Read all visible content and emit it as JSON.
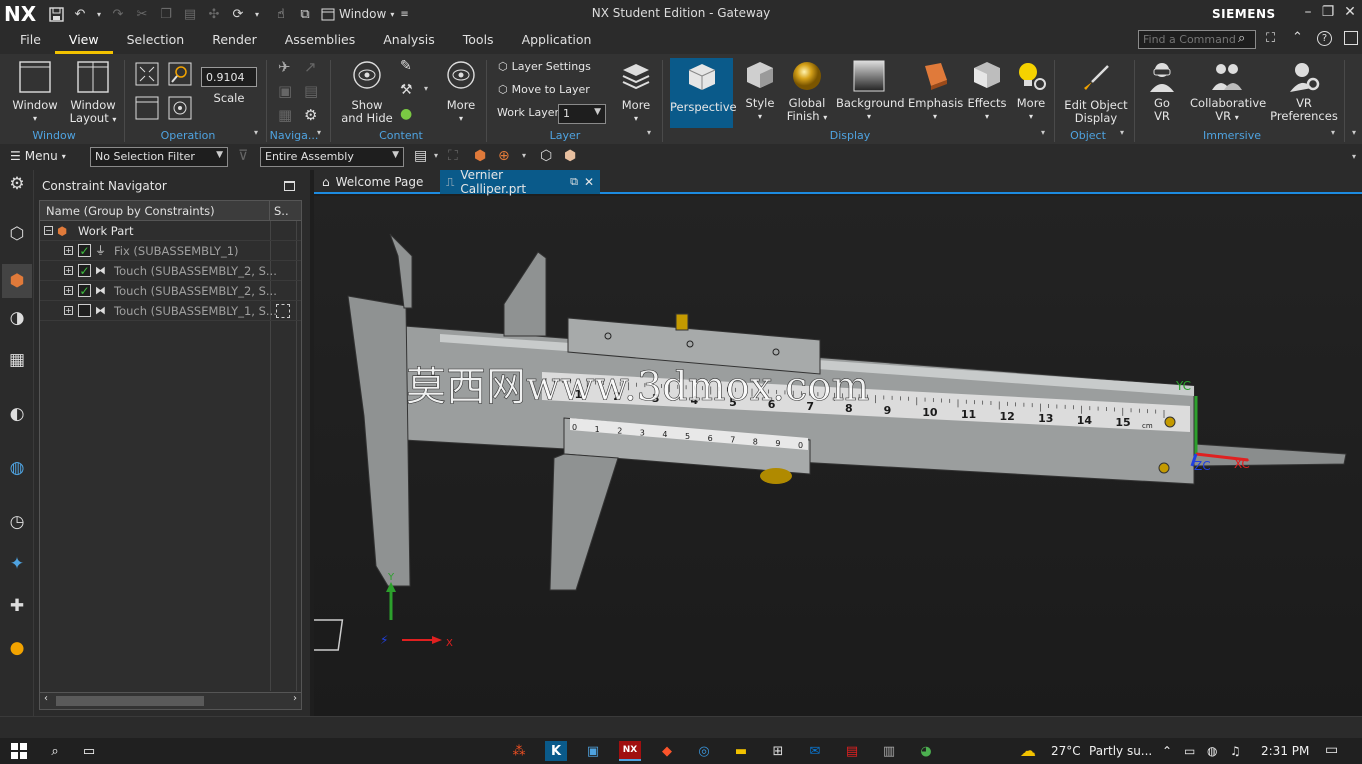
{
  "app": {
    "logo": "NX",
    "window_title": "NX Student Edition - Gateway",
    "window_menu_label": "Window",
    "brand": "SIEMENS",
    "accent_color": "#f2c200",
    "link_color": "#4fa3e0"
  },
  "menubar": {
    "tabs": [
      "File",
      "View",
      "Selection",
      "Render",
      "Assemblies",
      "Analysis",
      "Tools",
      "Application"
    ],
    "active_tab": "View",
    "find_command_placeholder": "Find a Command"
  },
  "ribbon": {
    "window_button": "Window",
    "window_layout_1": "Window",
    "window_layout_2": "Layout",
    "group_window": "Window",
    "scale_value": "0.9104",
    "scale_label": "Scale",
    "group_operation": "Operation",
    "group_navigation": "Naviga...",
    "show_hide_1": "Show",
    "show_hide_2": "and Hide",
    "content_more": "More",
    "group_content": "Content",
    "layer_settings": "Layer Settings",
    "move_to_layer": "Move to Layer",
    "work_layer_label": "Work Layer",
    "work_layer_value": "1",
    "layer_more": "More",
    "group_layer": "Layer",
    "perspective": "Perspective",
    "style": "Style",
    "global_finish_1": "Global",
    "global_finish_2": "Finish",
    "background": "Background",
    "emphasis": "Emphasis",
    "effects": "Effects",
    "display_more": "More",
    "group_display": "Display",
    "edit_object_display_1": "Edit Object",
    "edit_object_display_2": "Display",
    "group_object": "Object",
    "go_vr_1": "Go",
    "go_vr_2": "VR",
    "collab_vr_1": "Collaborative",
    "collab_vr_2": "VR",
    "vr_prefs_1": "VR",
    "vr_prefs_2": "Preferences",
    "group_immersive": "Immersive"
  },
  "toolbar2": {
    "menu_label": "Menu",
    "selection_filter": "No Selection Filter",
    "scope": "Entire Assembly"
  },
  "navigator": {
    "title": "Constraint Navigator",
    "col_name": "Name (Group by Constraints)",
    "col_status": "S..",
    "root": "Work Part",
    "rows": [
      {
        "label": "Fix (SUBASSEMBLY_1)",
        "checked": true
      },
      {
        "label": "Touch (SUBASSEMBLY_2, S...",
        "checked": true
      },
      {
        "label": "Touch (SUBASSEMBLY_2, S...",
        "checked": true
      },
      {
        "label": "Touch (SUBASSEMBLY_1, S...",
        "checked": false
      }
    ]
  },
  "tabs": {
    "welcome": "Welcome Page",
    "document": "Vernier Calliper.prt"
  },
  "viewport": {
    "watermark": "莫西网www.3dmox.com",
    "main_scale_numbers": [
      "1",
      "2",
      "3",
      "4",
      "5",
      "6",
      "7",
      "8",
      "9",
      "10",
      "11",
      "12",
      "13",
      "14",
      "15"
    ],
    "main_scale_unit": "cm",
    "vernier_numbers": [
      "0",
      "1",
      "2",
      "3",
      "4",
      "5",
      "6",
      "7",
      "8",
      "9",
      "0"
    ],
    "axis_xc": "XC",
    "axis_yc": "YC",
    "axis_zc": "ZC",
    "triad_x": "X",
    "triad_y": "Y"
  },
  "taskbar": {
    "weather": "27°C",
    "weather_text": "Partly su...",
    "time": "2:31 PM"
  }
}
